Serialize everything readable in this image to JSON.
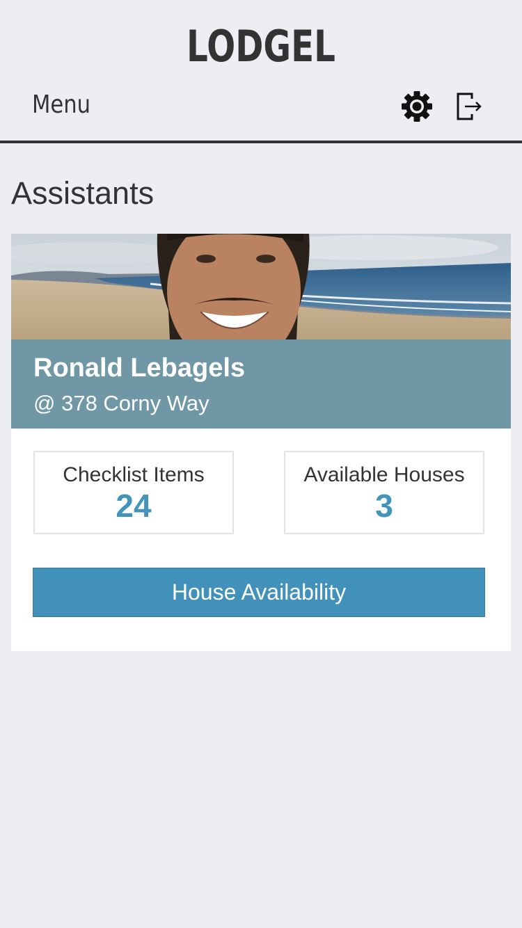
{
  "app": {
    "title": "LODGEL"
  },
  "nav": {
    "menu_label": "Menu",
    "settings_icon": "gear-icon",
    "logout_icon": "logout-icon"
  },
  "page": {
    "title": "Assistants"
  },
  "assistant_card": {
    "name": "Ronald Lebagels",
    "address": "@ 378 Corny Way",
    "stats": [
      {
        "label": "Checklist Items",
        "value": "24"
      },
      {
        "label": "Available Houses",
        "value": "3"
      }
    ],
    "action_label": "House Availability"
  },
  "colors": {
    "background": "#eceef3",
    "band": "#7097a6",
    "accent": "#4291ba",
    "stat_value": "#4493b9",
    "text": "#333333"
  }
}
